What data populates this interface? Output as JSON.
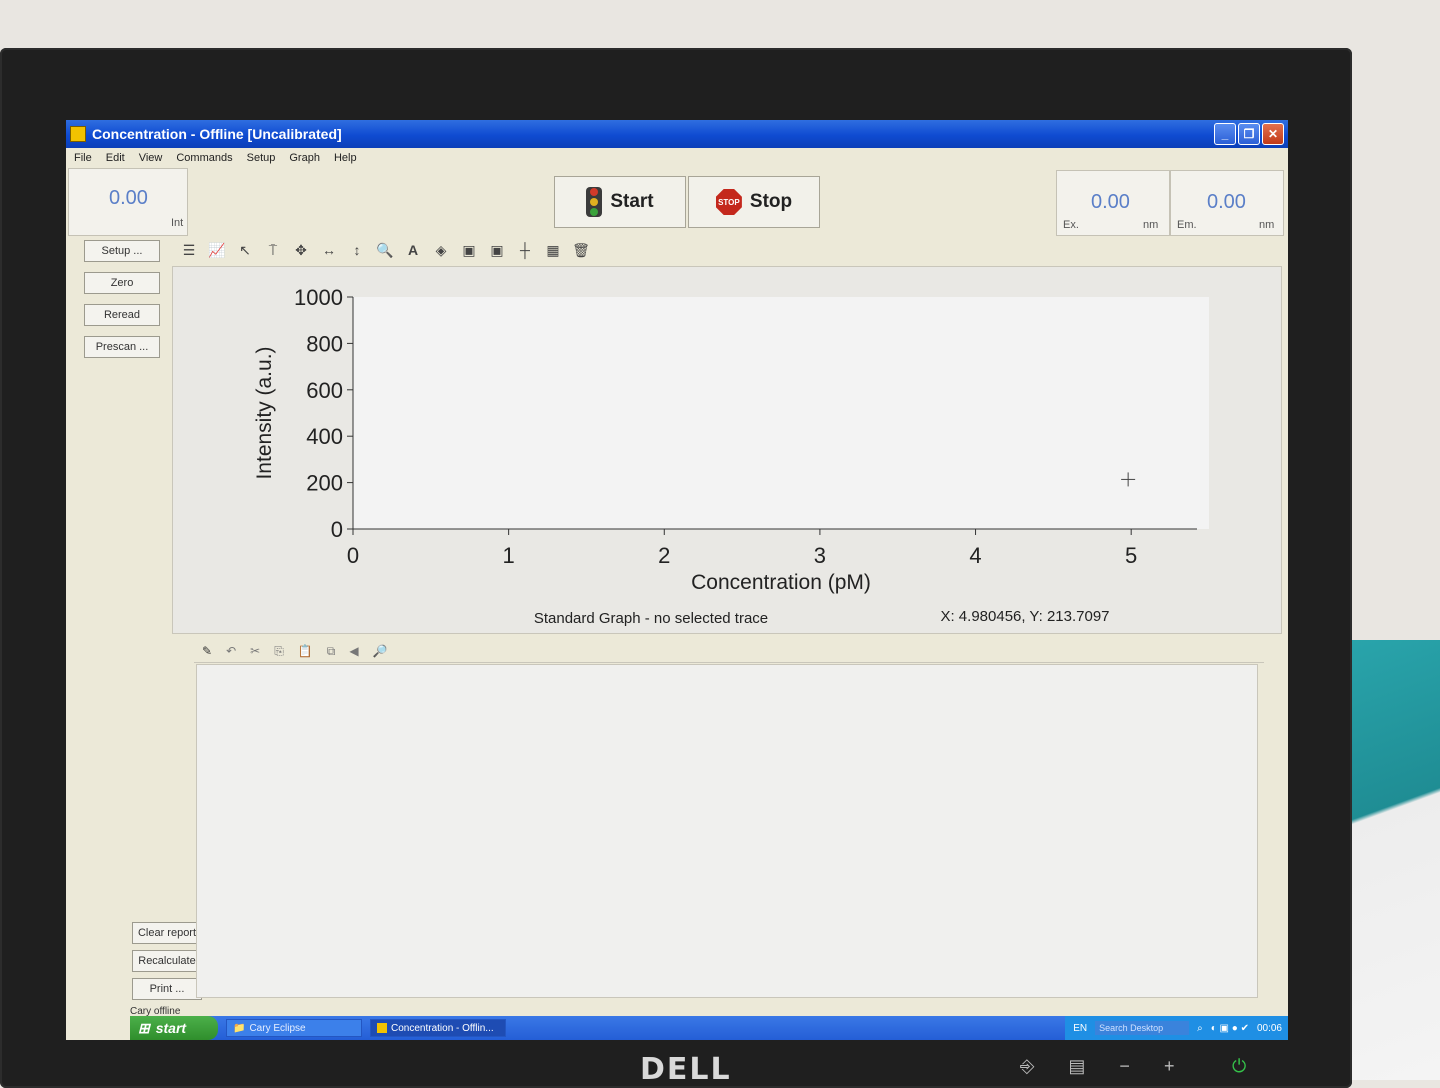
{
  "window": {
    "title": "Concentration - Offline [Uncalibrated]",
    "controls": [
      "_",
      "❐",
      "✕"
    ]
  },
  "menu": [
    "File",
    "Edit",
    "View",
    "Commands",
    "Setup",
    "Graph",
    "Help"
  ],
  "readouts": {
    "int_value": "0.00",
    "int_label": "Int",
    "ex_value": "0.00",
    "ex_label": "Ex.",
    "ex_unit": "nm",
    "em_value": "0.00",
    "em_label": "Em.",
    "em_unit": "nm"
  },
  "run": {
    "start_label": "Start",
    "stop_label": "Stop",
    "stop_sign_text": "STOP"
  },
  "left_buttons": [
    "Setup ...",
    "Zero",
    "Reread",
    "Prescan ..."
  ],
  "bottom_buttons": [
    "Clear report",
    "Recalculate",
    "Print ..."
  ],
  "toolbar_icons": [
    "trace-list-icon",
    "graph-icon",
    "pointer-icon",
    "marker-icon",
    "pan-icon",
    "horizontal-resize-icon",
    "vertical-resize-icon",
    "zoom-icon",
    "text-icon",
    "object-icon",
    "graph-view-1-icon",
    "graph-view-2-icon",
    "axis-icon",
    "chart-settings-icon",
    "delete-icon"
  ],
  "report_toolbar_icons": [
    "edit-icon",
    "undo-icon",
    "cut-icon",
    "copy-icon",
    "paste-icon",
    "copy-special-icon",
    "export-icon",
    "print-preview-icon"
  ],
  "graph": {
    "caption": "Standard Graph - no selected trace",
    "cursor_readout": "X: 4.980456, Y: 213.7097"
  },
  "chart_data": {
    "type": "scatter",
    "xlabel": "Concentration (pM)",
    "ylabel": "Intensity (a.u.)",
    "xlim": [
      0,
      5.5
    ],
    "ylim": [
      0,
      1000
    ],
    "x_ticks": [
      "0",
      "1",
      "2",
      "3",
      "4",
      "5"
    ],
    "y_ticks": [
      "0",
      "200",
      "400",
      "600",
      "800",
      "1000"
    ],
    "series": [],
    "cursor": {
      "x": 4.980456,
      "y": 213.7097
    },
    "grid": false
  },
  "status_text": "Cary offline",
  "taskbar": {
    "start_label": "start",
    "items": [
      "Cary Eclipse",
      "Concentration - Offlin..."
    ],
    "language": "EN",
    "search_placeholder": "Search Desktop",
    "clock": "00:06"
  },
  "monitor": {
    "brand": "DELL"
  }
}
